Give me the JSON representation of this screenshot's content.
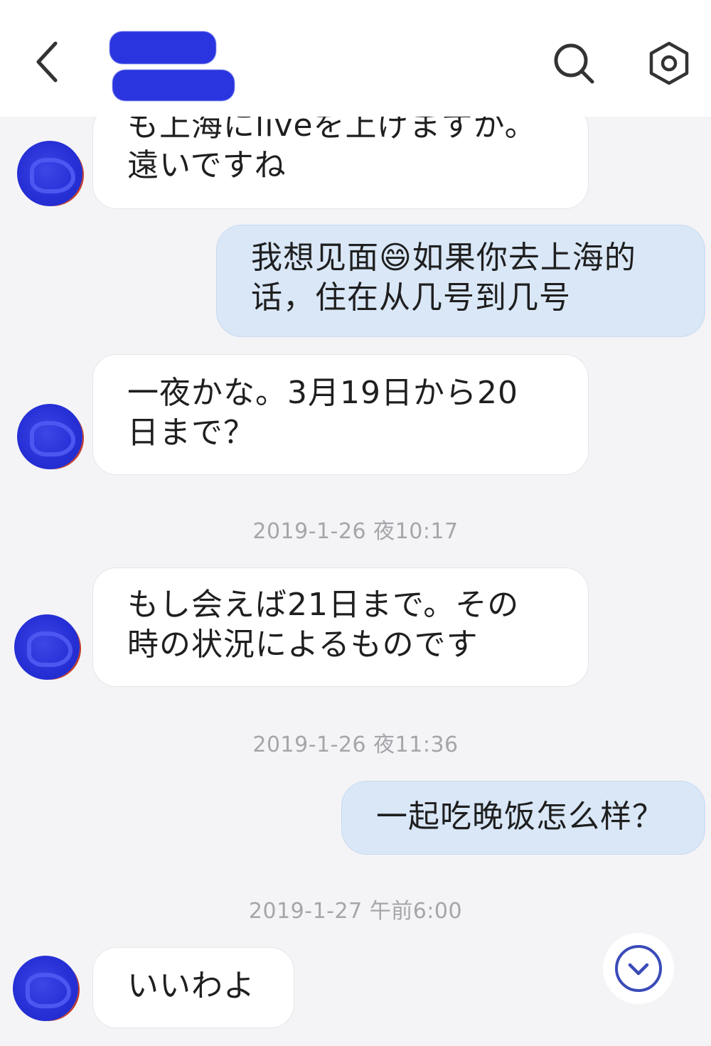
{
  "header": {
    "back_icon": "chevron-left-icon",
    "search_icon": "search-icon",
    "settings_icon": "settings-hexagon-icon"
  },
  "messages": [
    {
      "direction": "in",
      "text": "も上海にliveを上げますか。\n遠いですね"
    },
    {
      "direction": "out",
      "text": "我想见面😄如果你去上海的\n话，住在从几号到几号"
    },
    {
      "direction": "in",
      "text": "一夜かな。3月19日から20\n日まで？"
    },
    {
      "timestamp": "2019-1-26 夜10:17"
    },
    {
      "direction": "in",
      "text": "もし会えば21日まで。その\n時の状況によるものです"
    },
    {
      "timestamp": "2019-1-26 夜11:36"
    },
    {
      "direction": "out",
      "text": "一起吃晚饭怎么样？"
    },
    {
      "timestamp": "2019-1-27 午前6:00"
    },
    {
      "direction": "in",
      "text": "いいわよ"
    }
  ],
  "scroll_button_icon": "chevron-down-circle-icon",
  "colors": {
    "incoming_bubble": "#ffffff",
    "outgoing_bubble": "#d9e7f7",
    "background": "#f4f4f7",
    "timestamp_text": "#a5a5aa",
    "accent": "#3b4bb8"
  }
}
